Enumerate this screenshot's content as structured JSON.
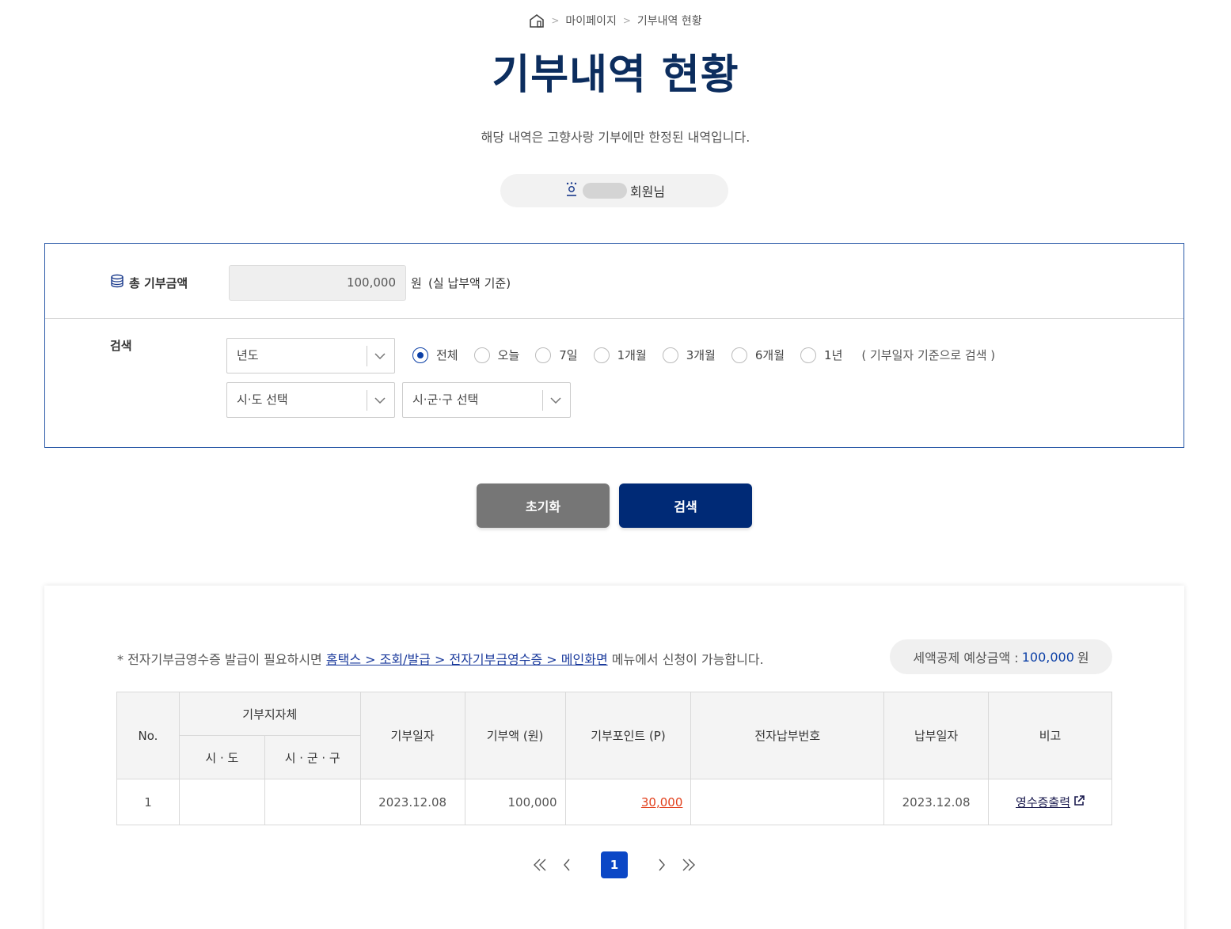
{
  "breadcrumb": {
    "home_icon": "home-icon",
    "level1": "마이페이지",
    "level2": "기부내역 현황"
  },
  "title": "기부내역 현황",
  "subtitle": "해당 내역은 고향사랑 기부에만 한정된 내역입니다.",
  "member": {
    "icon": "user-badge-icon",
    "suffix": "회원님"
  },
  "total": {
    "label": "총 기부금액",
    "value": "100,000",
    "unit": "원",
    "note": "(실 납부액 기준)"
  },
  "search": {
    "label": "검색",
    "year_select": "년도",
    "sido_select": "시·도 선택",
    "sigungu_select": "시·군·구 선택",
    "period_options": [
      "전체",
      "오늘",
      "7일",
      "1개월",
      "3개월",
      "6개월",
      "1년"
    ],
    "period_selected": "전체",
    "period_note": "( 기부일자 기준으로 검색 )"
  },
  "buttons": {
    "reset": "초기화",
    "search": "검색"
  },
  "notice": {
    "prefix": "* 전자기부금영수증 발급이 필요하시면 ",
    "link": "홈택스 > 조회/발급 > 전자기부금영수증 > 메인화면",
    "suffix": " 메뉴에서 신청이 가능합니다."
  },
  "tax": {
    "label": "세액공제 예상금액 : ",
    "amount": "100,000",
    "unit": " 원"
  },
  "table": {
    "headers": {
      "no": "No.",
      "org": "기부지자체",
      "sido": "시 · 도",
      "sigungu": "시 · 군 · 구",
      "date": "기부일자",
      "amount": "기부액 (원)",
      "point": "기부포인트 (P)",
      "epay": "전자납부번호",
      "paydate": "납부일자",
      "remark": "비고"
    },
    "rows": [
      {
        "no": "1",
        "sido": "",
        "sigungu": "",
        "date": "2023.12.08",
        "amount": "100,000",
        "point": "30,000",
        "epay": "",
        "paydate": "2023.12.08",
        "remark": "영수증출력"
      }
    ]
  },
  "pagination": {
    "current": "1"
  },
  "colors": {
    "navy": "#0c2d5e",
    "button_primary": "#002a76",
    "button_secondary": "#767676",
    "point_red": "#e2401c",
    "page_active": "#0b47c6"
  }
}
